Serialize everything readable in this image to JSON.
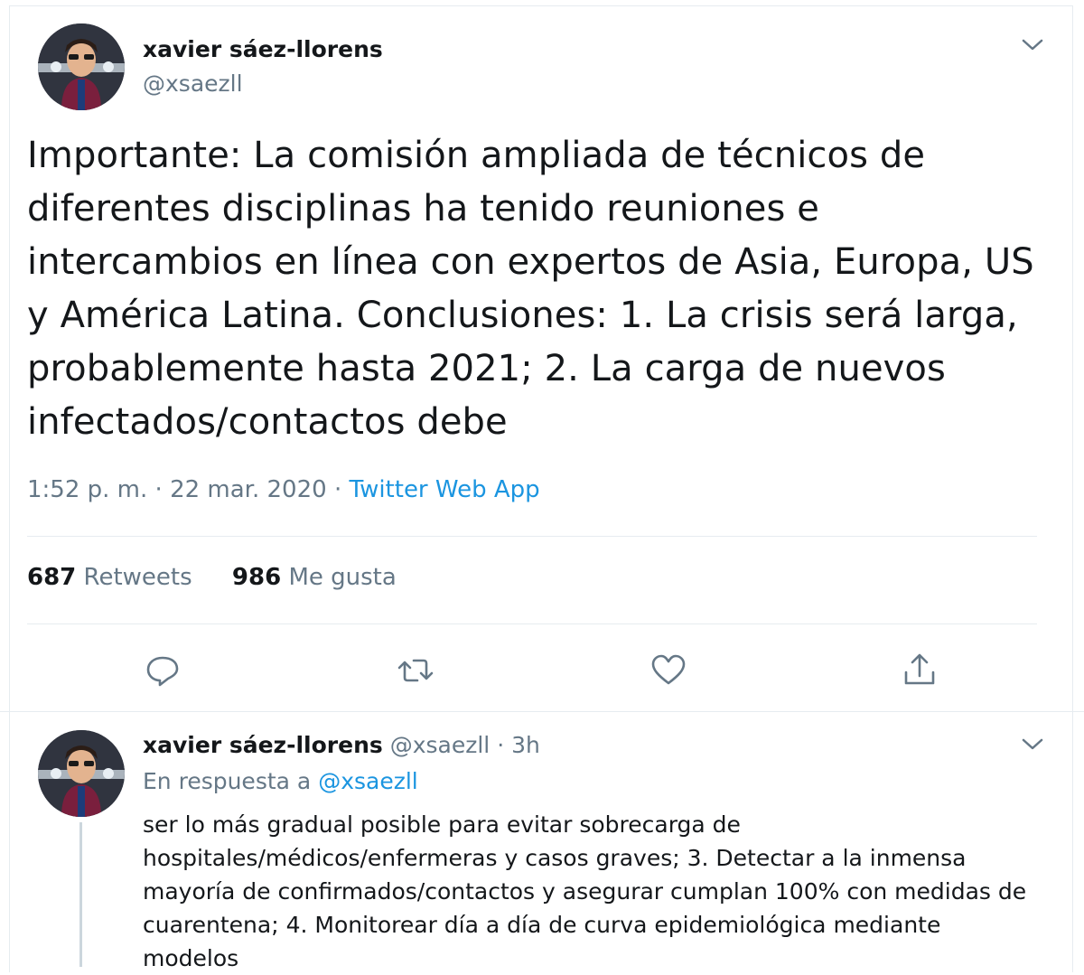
{
  "tweet": {
    "author_name": "xavier sáez-llorens",
    "author_handle": "@xsaezll",
    "text": "Importante: La comisión ampliada de técnicos de diferentes disciplinas ha tenido reuniones e intercambios en línea con expertos de Asia, Europa, US y América Latina. Conclusiones: 1. La crisis será larga, probablemente hasta 2021; 2. La carga de nuevos infectados/contactos debe",
    "timestamp": "1:52 p. m. · 22 mar. 2020 · ",
    "source": "Twitter Web App",
    "retweets_count": "687",
    "retweets_label": "Retweets",
    "likes_count": "986",
    "likes_label": "Me gusta",
    "icons": {
      "reply": "reply-icon",
      "retweet": "retweet-icon",
      "like": "heart-icon",
      "share": "share-icon",
      "menu": "chevron-down-icon"
    }
  },
  "reply": {
    "author_name": "xavier sáez-llorens",
    "meta": "@xsaezll · 3h",
    "replying_to_label": "En respuesta a",
    "replying_to_handle": "@xsaezll",
    "text": "ser lo más gradual posible para evitar sobrecarga de hospitales/médicos/enfermeras y casos graves; 3. Detectar a la inmensa mayoría de confirmados/contactos y asegurar cumplan 100% con medidas de cuarentena; 4. Monitorear día a día de curva epidemiológica mediante modelos"
  },
  "colors": {
    "link": "#1b95e0",
    "secondary_text": "#657786",
    "divider": "#e6ecf0",
    "thread_line": "#ccd6dd"
  }
}
